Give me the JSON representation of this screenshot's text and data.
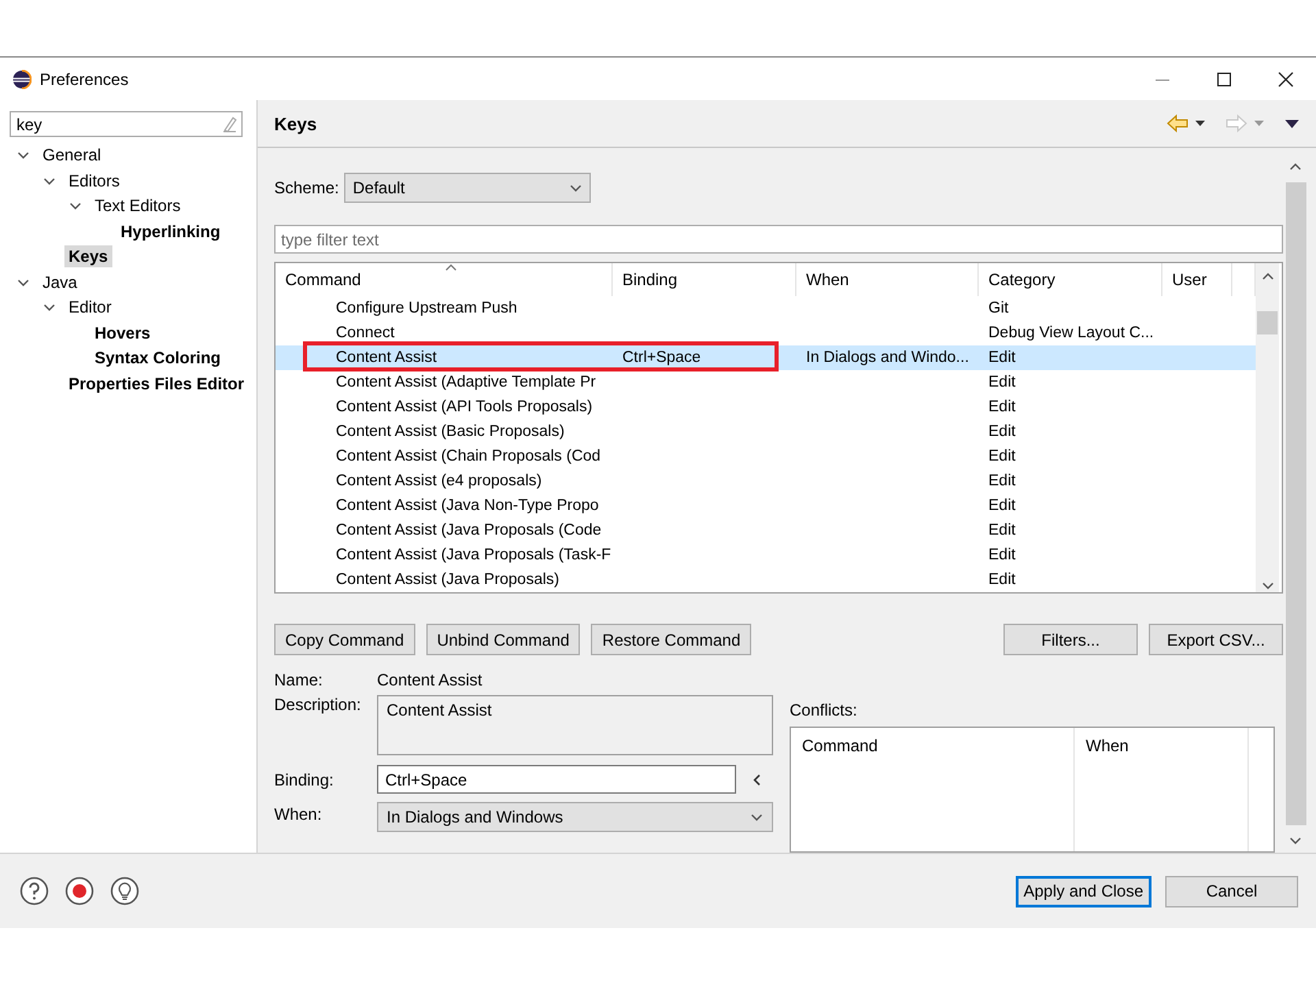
{
  "window": {
    "title": "Preferences"
  },
  "sidebar": {
    "filter": {
      "value": "key"
    },
    "tree": [
      {
        "label": "General",
        "expanded": true,
        "matched": false,
        "selected": false,
        "children": [
          {
            "label": "Editors",
            "expanded": true,
            "matched": false,
            "selected": false,
            "children": [
              {
                "label": "Text Editors",
                "expanded": true,
                "matched": false,
                "selected": false,
                "children": [
                  {
                    "label": "Hyperlinking",
                    "matched": true,
                    "selected": false
                  }
                ]
              }
            ]
          },
          {
            "label": "Keys",
            "matched": true,
            "selected": true
          }
        ]
      },
      {
        "label": "Java",
        "expanded": true,
        "matched": false,
        "selected": false,
        "children": [
          {
            "label": "Editor",
            "expanded": true,
            "matched": false,
            "selected": false,
            "children": [
              {
                "label": "Hovers",
                "matched": true,
                "selected": false
              },
              {
                "label": "Syntax Coloring",
                "matched": true,
                "selected": false
              }
            ]
          },
          {
            "label": "Properties Files Editor",
            "matched": true,
            "selected": false
          }
        ]
      }
    ]
  },
  "page": {
    "title": "Keys",
    "nav": [
      {
        "kind": "back",
        "disabled": false
      },
      {
        "kind": "forward",
        "disabled": true
      }
    ],
    "scheme": {
      "label": "Scheme:",
      "value": "Default"
    },
    "filter": {
      "placeholder": "type filter text"
    },
    "table": {
      "columns": [
        {
          "label": "Command",
          "sorted": true
        },
        {
          "label": "Binding",
          "sorted": false
        },
        {
          "label": "When",
          "sorted": false
        },
        {
          "label": "Category",
          "sorted": false
        },
        {
          "label": "User",
          "sorted": false
        }
      ],
      "rows": [
        {
          "command": "Configure Upstream Push",
          "category": "Git",
          "selected": false
        },
        {
          "command": "Connect",
          "category": "Debug View Layout C...",
          "selected": false
        },
        {
          "command": "Content Assist",
          "binding": "Ctrl+Space",
          "when": "In Dialogs and Windo...",
          "category": "Edit",
          "selected": true
        },
        {
          "command": "Content Assist (Adaptive Template Pr",
          "category": "Edit",
          "selected": false
        },
        {
          "command": "Content Assist (API Tools Proposals)",
          "category": "Edit",
          "selected": false
        },
        {
          "command": "Content Assist (Basic Proposals)",
          "category": "Edit",
          "selected": false
        },
        {
          "command": "Content Assist (Chain Proposals (Cod",
          "category": "Edit",
          "selected": false
        },
        {
          "command": "Content Assist (e4 proposals)",
          "category": "Edit",
          "selected": false
        },
        {
          "command": "Content Assist (Java Non-Type Propo",
          "category": "Edit",
          "selected": false
        },
        {
          "command": "Content Assist (Java Proposals (Code",
          "category": "Edit",
          "selected": false
        },
        {
          "command": "Content Assist (Java Proposals (Task-F",
          "category": "Edit",
          "selected": false
        },
        {
          "command": "Content Assist (Java Proposals)",
          "category": "Edit",
          "selected": false
        }
      ]
    },
    "buttons": [
      "Copy Command",
      "Unbind Command",
      "Restore Command"
    ],
    "right_buttons": [
      "Filters...",
      "Export CSV..."
    ],
    "details": {
      "name_label": "Name:",
      "name": "Content Assist",
      "description_label": "Description:",
      "description": "Content Assist",
      "binding_label": "Binding:",
      "binding": "Ctrl+Space",
      "when_label": "When:",
      "when": "In Dialogs and Windows"
    },
    "conflicts": {
      "label": "Conflicts:",
      "columns": [
        "Command",
        "When"
      ]
    }
  },
  "footer": {
    "buttons": [
      {
        "label": "Apply and Close",
        "default": true
      },
      {
        "label": "Cancel",
        "default": false
      }
    ]
  }
}
